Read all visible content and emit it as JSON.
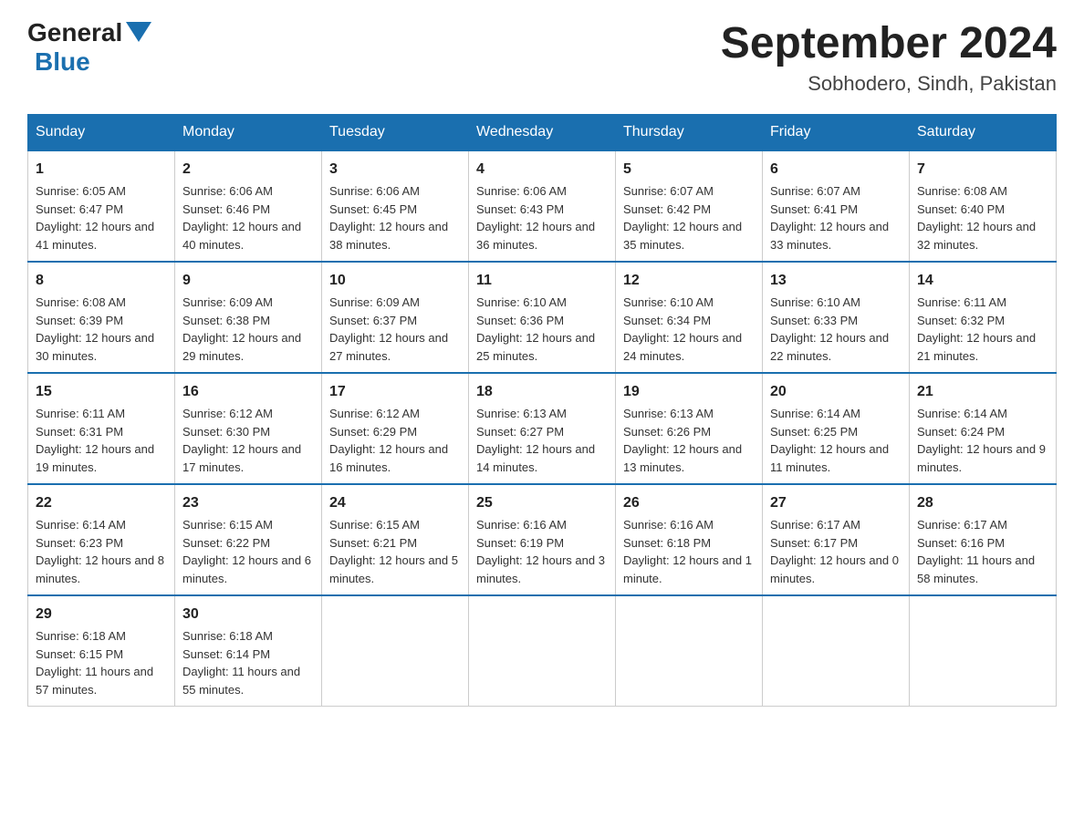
{
  "logo": {
    "general": "General",
    "blue": "Blue"
  },
  "title": "September 2024",
  "location": "Sobhodero, Sindh, Pakistan",
  "days_of_week": [
    "Sunday",
    "Monday",
    "Tuesday",
    "Wednesday",
    "Thursday",
    "Friday",
    "Saturday"
  ],
  "weeks": [
    [
      {
        "day": "1",
        "sunrise": "6:05 AM",
        "sunset": "6:47 PM",
        "daylight": "12 hours and 41 minutes."
      },
      {
        "day": "2",
        "sunrise": "6:06 AM",
        "sunset": "6:46 PM",
        "daylight": "12 hours and 40 minutes."
      },
      {
        "day": "3",
        "sunrise": "6:06 AM",
        "sunset": "6:45 PM",
        "daylight": "12 hours and 38 minutes."
      },
      {
        "day": "4",
        "sunrise": "6:06 AM",
        "sunset": "6:43 PM",
        "daylight": "12 hours and 36 minutes."
      },
      {
        "day": "5",
        "sunrise": "6:07 AM",
        "sunset": "6:42 PM",
        "daylight": "12 hours and 35 minutes."
      },
      {
        "day": "6",
        "sunrise": "6:07 AM",
        "sunset": "6:41 PM",
        "daylight": "12 hours and 33 minutes."
      },
      {
        "day": "7",
        "sunrise": "6:08 AM",
        "sunset": "6:40 PM",
        "daylight": "12 hours and 32 minutes."
      }
    ],
    [
      {
        "day": "8",
        "sunrise": "6:08 AM",
        "sunset": "6:39 PM",
        "daylight": "12 hours and 30 minutes."
      },
      {
        "day": "9",
        "sunrise": "6:09 AM",
        "sunset": "6:38 PM",
        "daylight": "12 hours and 29 minutes."
      },
      {
        "day": "10",
        "sunrise": "6:09 AM",
        "sunset": "6:37 PM",
        "daylight": "12 hours and 27 minutes."
      },
      {
        "day": "11",
        "sunrise": "6:10 AM",
        "sunset": "6:36 PM",
        "daylight": "12 hours and 25 minutes."
      },
      {
        "day": "12",
        "sunrise": "6:10 AM",
        "sunset": "6:34 PM",
        "daylight": "12 hours and 24 minutes."
      },
      {
        "day": "13",
        "sunrise": "6:10 AM",
        "sunset": "6:33 PM",
        "daylight": "12 hours and 22 minutes."
      },
      {
        "day": "14",
        "sunrise": "6:11 AM",
        "sunset": "6:32 PM",
        "daylight": "12 hours and 21 minutes."
      }
    ],
    [
      {
        "day": "15",
        "sunrise": "6:11 AM",
        "sunset": "6:31 PM",
        "daylight": "12 hours and 19 minutes."
      },
      {
        "day": "16",
        "sunrise": "6:12 AM",
        "sunset": "6:30 PM",
        "daylight": "12 hours and 17 minutes."
      },
      {
        "day": "17",
        "sunrise": "6:12 AM",
        "sunset": "6:29 PM",
        "daylight": "12 hours and 16 minutes."
      },
      {
        "day": "18",
        "sunrise": "6:13 AM",
        "sunset": "6:27 PM",
        "daylight": "12 hours and 14 minutes."
      },
      {
        "day": "19",
        "sunrise": "6:13 AM",
        "sunset": "6:26 PM",
        "daylight": "12 hours and 13 minutes."
      },
      {
        "day": "20",
        "sunrise": "6:14 AM",
        "sunset": "6:25 PM",
        "daylight": "12 hours and 11 minutes."
      },
      {
        "day": "21",
        "sunrise": "6:14 AM",
        "sunset": "6:24 PM",
        "daylight": "12 hours and 9 minutes."
      }
    ],
    [
      {
        "day": "22",
        "sunrise": "6:14 AM",
        "sunset": "6:23 PM",
        "daylight": "12 hours and 8 minutes."
      },
      {
        "day": "23",
        "sunrise": "6:15 AM",
        "sunset": "6:22 PM",
        "daylight": "12 hours and 6 minutes."
      },
      {
        "day": "24",
        "sunrise": "6:15 AM",
        "sunset": "6:21 PM",
        "daylight": "12 hours and 5 minutes."
      },
      {
        "day": "25",
        "sunrise": "6:16 AM",
        "sunset": "6:19 PM",
        "daylight": "12 hours and 3 minutes."
      },
      {
        "day": "26",
        "sunrise": "6:16 AM",
        "sunset": "6:18 PM",
        "daylight": "12 hours and 1 minute."
      },
      {
        "day": "27",
        "sunrise": "6:17 AM",
        "sunset": "6:17 PM",
        "daylight": "12 hours and 0 minutes."
      },
      {
        "day": "28",
        "sunrise": "6:17 AM",
        "sunset": "6:16 PM",
        "daylight": "11 hours and 58 minutes."
      }
    ],
    [
      {
        "day": "29",
        "sunrise": "6:18 AM",
        "sunset": "6:15 PM",
        "daylight": "11 hours and 57 minutes."
      },
      {
        "day": "30",
        "sunrise": "6:18 AM",
        "sunset": "6:14 PM",
        "daylight": "11 hours and 55 minutes."
      },
      null,
      null,
      null,
      null,
      null
    ]
  ]
}
